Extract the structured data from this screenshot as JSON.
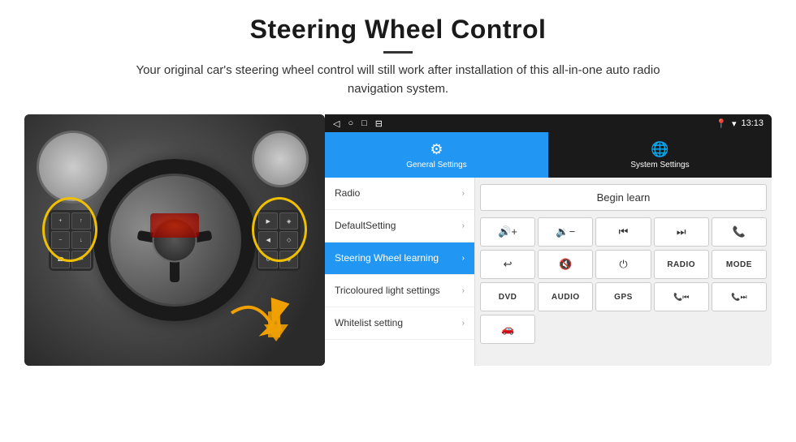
{
  "header": {
    "title": "Steering Wheel Control",
    "description": "Your original car's steering wheel control will still work after installation of this all-in-one auto radio navigation system."
  },
  "status_bar": {
    "time": "13:13",
    "icons": [
      "◁",
      "○",
      "□",
      "⊟"
    ]
  },
  "tabs": [
    {
      "id": "general",
      "label": "General Settings",
      "icon": "⚙",
      "active": true
    },
    {
      "id": "system",
      "label": "System Settings",
      "icon": "🌐",
      "active": false
    }
  ],
  "menu_items": [
    {
      "id": "radio",
      "label": "Radio",
      "active": false
    },
    {
      "id": "default",
      "label": "DefaultSetting",
      "active": false
    },
    {
      "id": "steering",
      "label": "Steering Wheel learning",
      "active": true
    },
    {
      "id": "tricoloured",
      "label": "Tricoloured light settings",
      "active": false
    },
    {
      "id": "whitelist",
      "label": "Whitelist setting",
      "active": false
    }
  ],
  "controls": {
    "begin_learn": "Begin learn",
    "row1": [
      {
        "id": "vol-up",
        "label": "🔊+",
        "type": "icon"
      },
      {
        "id": "vol-down",
        "label": "🔉−",
        "type": "icon"
      },
      {
        "id": "prev",
        "label": "⏮",
        "type": "icon"
      },
      {
        "id": "next",
        "label": "⏭",
        "type": "icon"
      },
      {
        "id": "phone",
        "label": "📞",
        "type": "icon"
      }
    ],
    "row2": [
      {
        "id": "hangup",
        "label": "↩",
        "type": "icon"
      },
      {
        "id": "mute",
        "label": "🔇",
        "type": "icon"
      },
      {
        "id": "power",
        "label": "⏻",
        "type": "icon"
      },
      {
        "id": "radio-btn",
        "label": "RADIO",
        "type": "text"
      },
      {
        "id": "mode",
        "label": "MODE",
        "type": "text"
      }
    ],
    "row3": [
      {
        "id": "dvd",
        "label": "DVD",
        "type": "text"
      },
      {
        "id": "audio",
        "label": "AUDIO",
        "type": "text"
      },
      {
        "id": "gps",
        "label": "GPS",
        "type": "text"
      },
      {
        "id": "tel-prev",
        "label": "📞⏮",
        "type": "icon"
      },
      {
        "id": "tel-next",
        "label": "📞⏭",
        "type": "icon"
      }
    ],
    "row4": [
      {
        "id": "extra",
        "label": "🚗",
        "type": "icon"
      }
    ]
  },
  "colors": {
    "accent_blue": "#2196F3",
    "dark_bg": "#1a1a1a",
    "white": "#ffffff",
    "light_bg": "#f0f0f0"
  }
}
